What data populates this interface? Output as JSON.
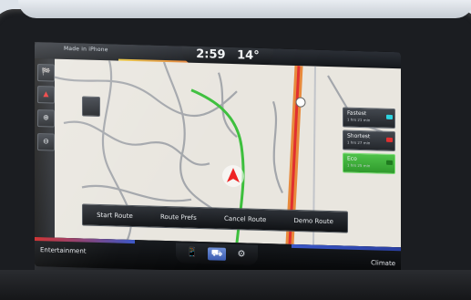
{
  "status_bar": {
    "source": "Made in iPhone",
    "time": "2:59",
    "temperature": "14°"
  },
  "left_rail": {
    "buttons": [
      {
        "icon": "destination-icon",
        "label": "🏁"
      },
      {
        "icon": "navigation-arrow-icon",
        "label": "▲"
      },
      {
        "icon": "zoom-in-icon",
        "label": "⊕"
      },
      {
        "icon": "zoom-out-icon",
        "label": "⊖"
      }
    ]
  },
  "route_options": [
    {
      "label": "Fastest",
      "detail": "1 hrs 21 min",
      "color": "#2dd4e0",
      "active": false
    },
    {
      "label": "Shortest",
      "detail": "1 hrs 27 min",
      "color": "#e03030",
      "active": false
    },
    {
      "label": "Eco",
      "detail": "1 hrs 25 min",
      "color": "#38c45a",
      "active": true
    }
  ],
  "route_actions": [
    "Start Route",
    "Route Prefs",
    "Cancel Route",
    "Demo Route"
  ],
  "bottom_bar": {
    "left_label": "Entertainment",
    "right_label": "Climate",
    "tabs": [
      {
        "icon": "phone-icon",
        "label": "📱"
      },
      {
        "icon": "navigation-icon",
        "label": "⛟"
      },
      {
        "icon": "settings-icon",
        "label": "⚙"
      }
    ]
  },
  "colors": {
    "eco_green": "#38c45a",
    "route_red": "#e03030",
    "highway_orange": "#e88a3c"
  }
}
